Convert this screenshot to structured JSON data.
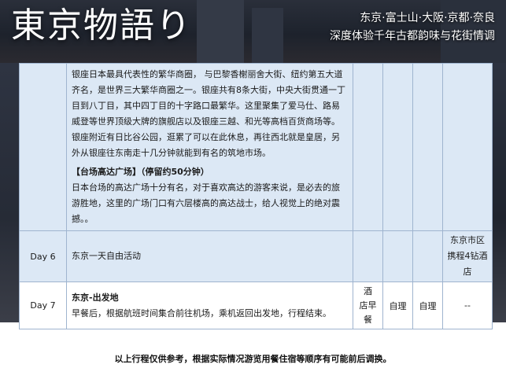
{
  "header": {
    "title": "東京物語り",
    "sub_line1": "东京·富士山·大阪·京都·奈良",
    "sub_line2": "深度体验千年古都韵味与花街情调"
  },
  "itinerary": {
    "day5": {
      "para1": "银座日本最具代表性的繁华商圈，  与巴黎香榭丽舍大街、纽约第五大道齐名，是世界三大繁华商圈之一。银座共有8条大街，中央大街贯通一丁目到八丁目，其中四丁目的十字路口最繁华。这里聚集了爱马仕、路易威登等世界顶级大牌的旗舰店以及银座三越、和光等高档百货商场等。银座附近有日比谷公园，逛累了可以在此休息，再往西北就是皇居，另外从银座往东南走十几分钟就能到有名的筑地市场。",
      "section_title": "【台场高达广场】（停留约50分钟）",
      "para2": "日本台场的高达广场十分有名，对于喜欢高达的游客来说，是必去的旅游胜地，这里的广场门口有六层楼高的高达战士，给人视觉上的绝对震撼。。"
    },
    "day6": {
      "day": "Day 6",
      "desc": "东京一天自由活动",
      "hotel": "东京市区携程4钻酒店"
    },
    "day7": {
      "day": "Day 7",
      "title": "东京-出发地",
      "desc": "早餐后，根据航班时间集合前往机场，乘机返回出发地，行程结束。",
      "breakfast": "酒 店早餐",
      "lunch": "自理",
      "dinner": "自理",
      "hotel": "--"
    }
  },
  "footer_note": "以上行程仅供参考，根据实际情况游览用餐住宿等顺序有可能前后调换。"
}
